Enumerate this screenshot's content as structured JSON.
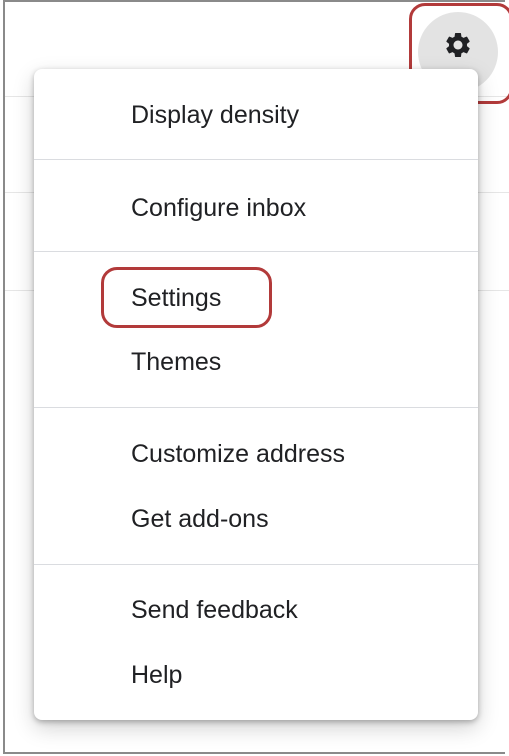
{
  "toolbar": {
    "settings_icon": "gear-icon"
  },
  "menu": {
    "items": [
      {
        "label": "Display density"
      },
      {
        "label": "Configure inbox"
      },
      {
        "label": "Settings"
      },
      {
        "label": "Themes"
      },
      {
        "label": "Customize address"
      },
      {
        "label": "Get add-ons"
      },
      {
        "label": "Send feedback"
      },
      {
        "label": "Help"
      }
    ]
  },
  "highlight": {
    "color": "#b23a3a",
    "targets": [
      "gear-icon",
      "Settings"
    ]
  }
}
